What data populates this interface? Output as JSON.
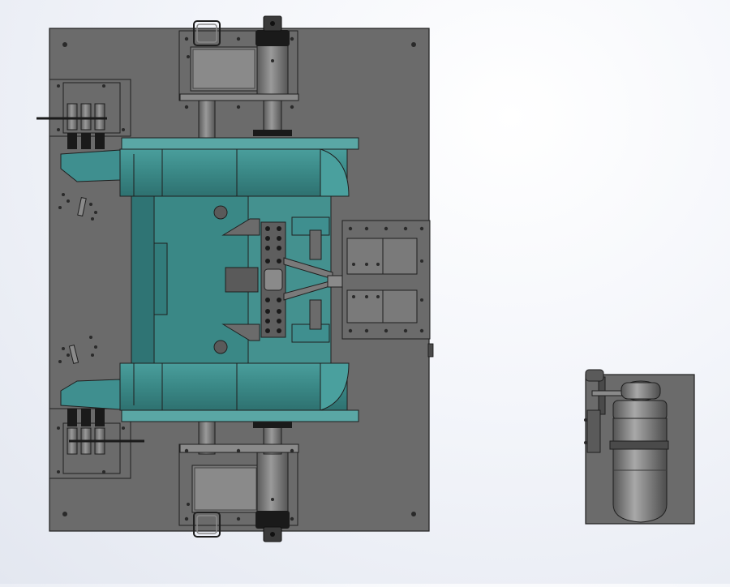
{
  "view": {
    "colors": {
      "plate": "#6b6b6b",
      "plate_edge": "#1f1f1f",
      "teal": "#3f8f8f",
      "teal_dark": "#2f7474",
      "teal_light": "#5aa7a5",
      "steel": "#8a8a8a",
      "steel_dark": "#4a4a4a",
      "black": "#1a1a1a",
      "background": "#eef1f7"
    },
    "components": [
      "base-plate",
      "teal-body",
      "top-clamp-assembly",
      "bottom-clamp-assembly",
      "left-top-bracket",
      "left-bottom-bracket",
      "right-slide-plate",
      "motor-unit"
    ]
  }
}
